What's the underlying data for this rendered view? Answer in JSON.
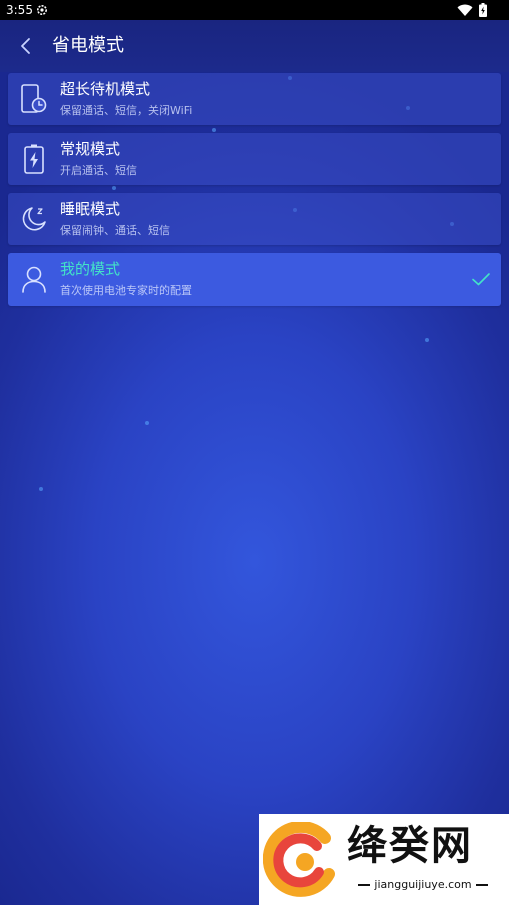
{
  "status_bar": {
    "time": "3:55",
    "icons": [
      "gear-icon",
      "wifi-icon",
      "battery-icon"
    ]
  },
  "header": {
    "title": "省电模式",
    "back_icon": "chevron-left-icon"
  },
  "modes": [
    {
      "title": "超长待机模式",
      "subtitle": "保留通话、短信，关闭WiFi",
      "icon": "phone-clock-icon",
      "selected": false
    },
    {
      "title": "常规模式",
      "subtitle": "开启通话、短信",
      "icon": "battery-charging-icon",
      "selected": false
    },
    {
      "title": "睡眠模式",
      "subtitle": "保留闹钟、通话、短信",
      "icon": "moon-icon",
      "selected": false
    },
    {
      "title": "我的模式",
      "subtitle": "首次使用电池专家时的配置",
      "icon": "user-icon",
      "selected": true
    }
  ],
  "colors": {
    "accent": "#43e3c8",
    "selected_bg": "#3c5ae0",
    "item_bg": "#3a4ec8"
  },
  "watermark": {
    "name": "绛癸网",
    "url": "jiangguijiuye.com"
  }
}
